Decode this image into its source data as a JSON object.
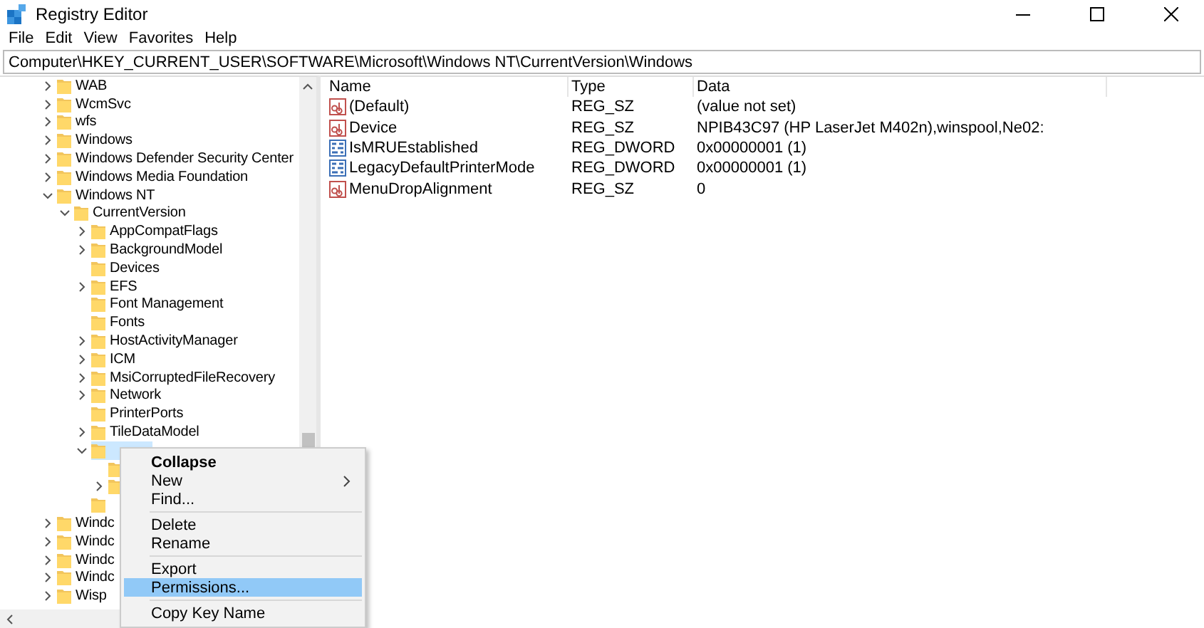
{
  "window": {
    "title": "Registry Editor"
  },
  "menu_bar": [
    "File",
    "Edit",
    "View",
    "Favorites",
    "Help"
  ],
  "address": "Computer\\HKEY_CURRENT_USER\\SOFTWARE\\Microsoft\\Windows NT\\CurrentVersion\\Windows",
  "tree": [
    {
      "name": "WAB",
      "kind": "branch",
      "expanded": false,
      "selected": false
    },
    {
      "name": "WcmSvc",
      "kind": "branch",
      "expanded": false,
      "selected": false
    },
    {
      "name": "wfs",
      "kind": "branch",
      "expanded": false,
      "selected": false
    },
    {
      "name": "Windows",
      "kind": "branch",
      "expanded": false,
      "selected": false
    },
    {
      "name": "Windows Defender Security Center",
      "kind": "branch",
      "expanded": false,
      "selected": false
    },
    {
      "name": "Windows Media Foundation",
      "kind": "branch",
      "expanded": false,
      "selected": false
    },
    {
      "name": "Windows NT",
      "kind": "branch",
      "expanded": true,
      "selected": false,
      "children": [
        {
          "name": "CurrentVersion",
          "kind": "branch",
          "expanded": true,
          "selected": false,
          "children": [
            {
              "name": "AppCompatFlags",
              "kind": "branch",
              "expanded": false,
              "selected": false
            },
            {
              "name": "BackgroundModel",
              "kind": "branch",
              "expanded": false,
              "selected": false
            },
            {
              "name": "Devices",
              "kind": "leaf",
              "selected": false
            },
            {
              "name": "EFS",
              "kind": "branch",
              "expanded": false,
              "selected": false
            },
            {
              "name": "Font Management",
              "kind": "leaf",
              "selected": false
            },
            {
              "name": "Fonts",
              "kind": "leaf",
              "selected": false
            },
            {
              "name": "HostActivityManager",
              "kind": "branch",
              "expanded": false,
              "selected": false
            },
            {
              "name": "ICM",
              "kind": "branch",
              "expanded": false,
              "selected": false
            },
            {
              "name": "MsiCorruptedFileRecovery",
              "kind": "branch",
              "expanded": false,
              "selected": false
            },
            {
              "name": "Network",
              "kind": "branch",
              "expanded": false,
              "selected": false
            },
            {
              "name": "PrinterPorts",
              "kind": "leaf",
              "selected": false
            },
            {
              "name": "TileDataModel",
              "kind": "branch",
              "expanded": false,
              "selected": false
            },
            {
              "kind": "branch",
              "expanded": true,
              "selected": true,
              "children": [
                {
                  "kind": "leaf",
                  "selected": false
                },
                {
                  "kind": "branch",
                  "expanded": false,
                  "selected": false
                }
              ]
            },
            {
              "kind": "leaf",
              "selected": false
            }
          ]
        }
      ]
    },
    {
      "name": "Windc",
      "kind": "branch",
      "expanded": false,
      "selected": false
    },
    {
      "name": "Windc",
      "kind": "branch",
      "expanded": false,
      "selected": false
    },
    {
      "name": "Windc",
      "kind": "branch",
      "expanded": false,
      "selected": false
    },
    {
      "name": "Windc",
      "kind": "branch",
      "expanded": false,
      "selected": false
    },
    {
      "name": "Wisp",
      "kind": "branch",
      "expanded": false,
      "selected": false
    }
  ],
  "values": {
    "columns": [
      "Name",
      "Type",
      "Data"
    ],
    "rows": [
      {
        "kind": "string",
        "name": "(Default)",
        "type": "REG_SZ",
        "data": "(value not set)"
      },
      {
        "kind": "string",
        "name": "Device",
        "type": "REG_SZ",
        "data": "NPIB43C97 (HP LaserJet M402n),winspool,Ne02:"
      },
      {
        "kind": "number",
        "name": "IsMRUEstablished",
        "type": "REG_DWORD",
        "data": "0x00000001 (1)"
      },
      {
        "kind": "number",
        "name": "LegacyDefaultPrinterMode",
        "type": "REG_DWORD",
        "data": "0x00000001 (1)"
      },
      {
        "kind": "string",
        "name": "MenuDropAlignment",
        "type": "REG_SZ",
        "data": "0"
      }
    ]
  },
  "context_menu": [
    {
      "kind": "item",
      "label": "Collapse",
      "default": true,
      "submenu": false,
      "selected": false
    },
    {
      "kind": "item",
      "label": "New",
      "default": false,
      "submenu": true,
      "selected": false
    },
    {
      "kind": "item",
      "label": "Find...",
      "default": false,
      "submenu": false,
      "selected": false
    },
    {
      "kind": "separator"
    },
    {
      "kind": "item",
      "label": "Delete",
      "default": false,
      "submenu": false,
      "selected": false
    },
    {
      "kind": "item",
      "label": "Rename",
      "default": false,
      "submenu": false,
      "selected": false
    },
    {
      "kind": "separator"
    },
    {
      "kind": "item",
      "label": "Export",
      "default": false,
      "submenu": false,
      "selected": false
    },
    {
      "kind": "item",
      "label": "Permissions...",
      "default": false,
      "submenu": false,
      "selected": true
    },
    {
      "kind": "separator"
    },
    {
      "kind": "item",
      "label": "Copy Key Name",
      "default": false,
      "submenu": false,
      "selected": false
    }
  ]
}
